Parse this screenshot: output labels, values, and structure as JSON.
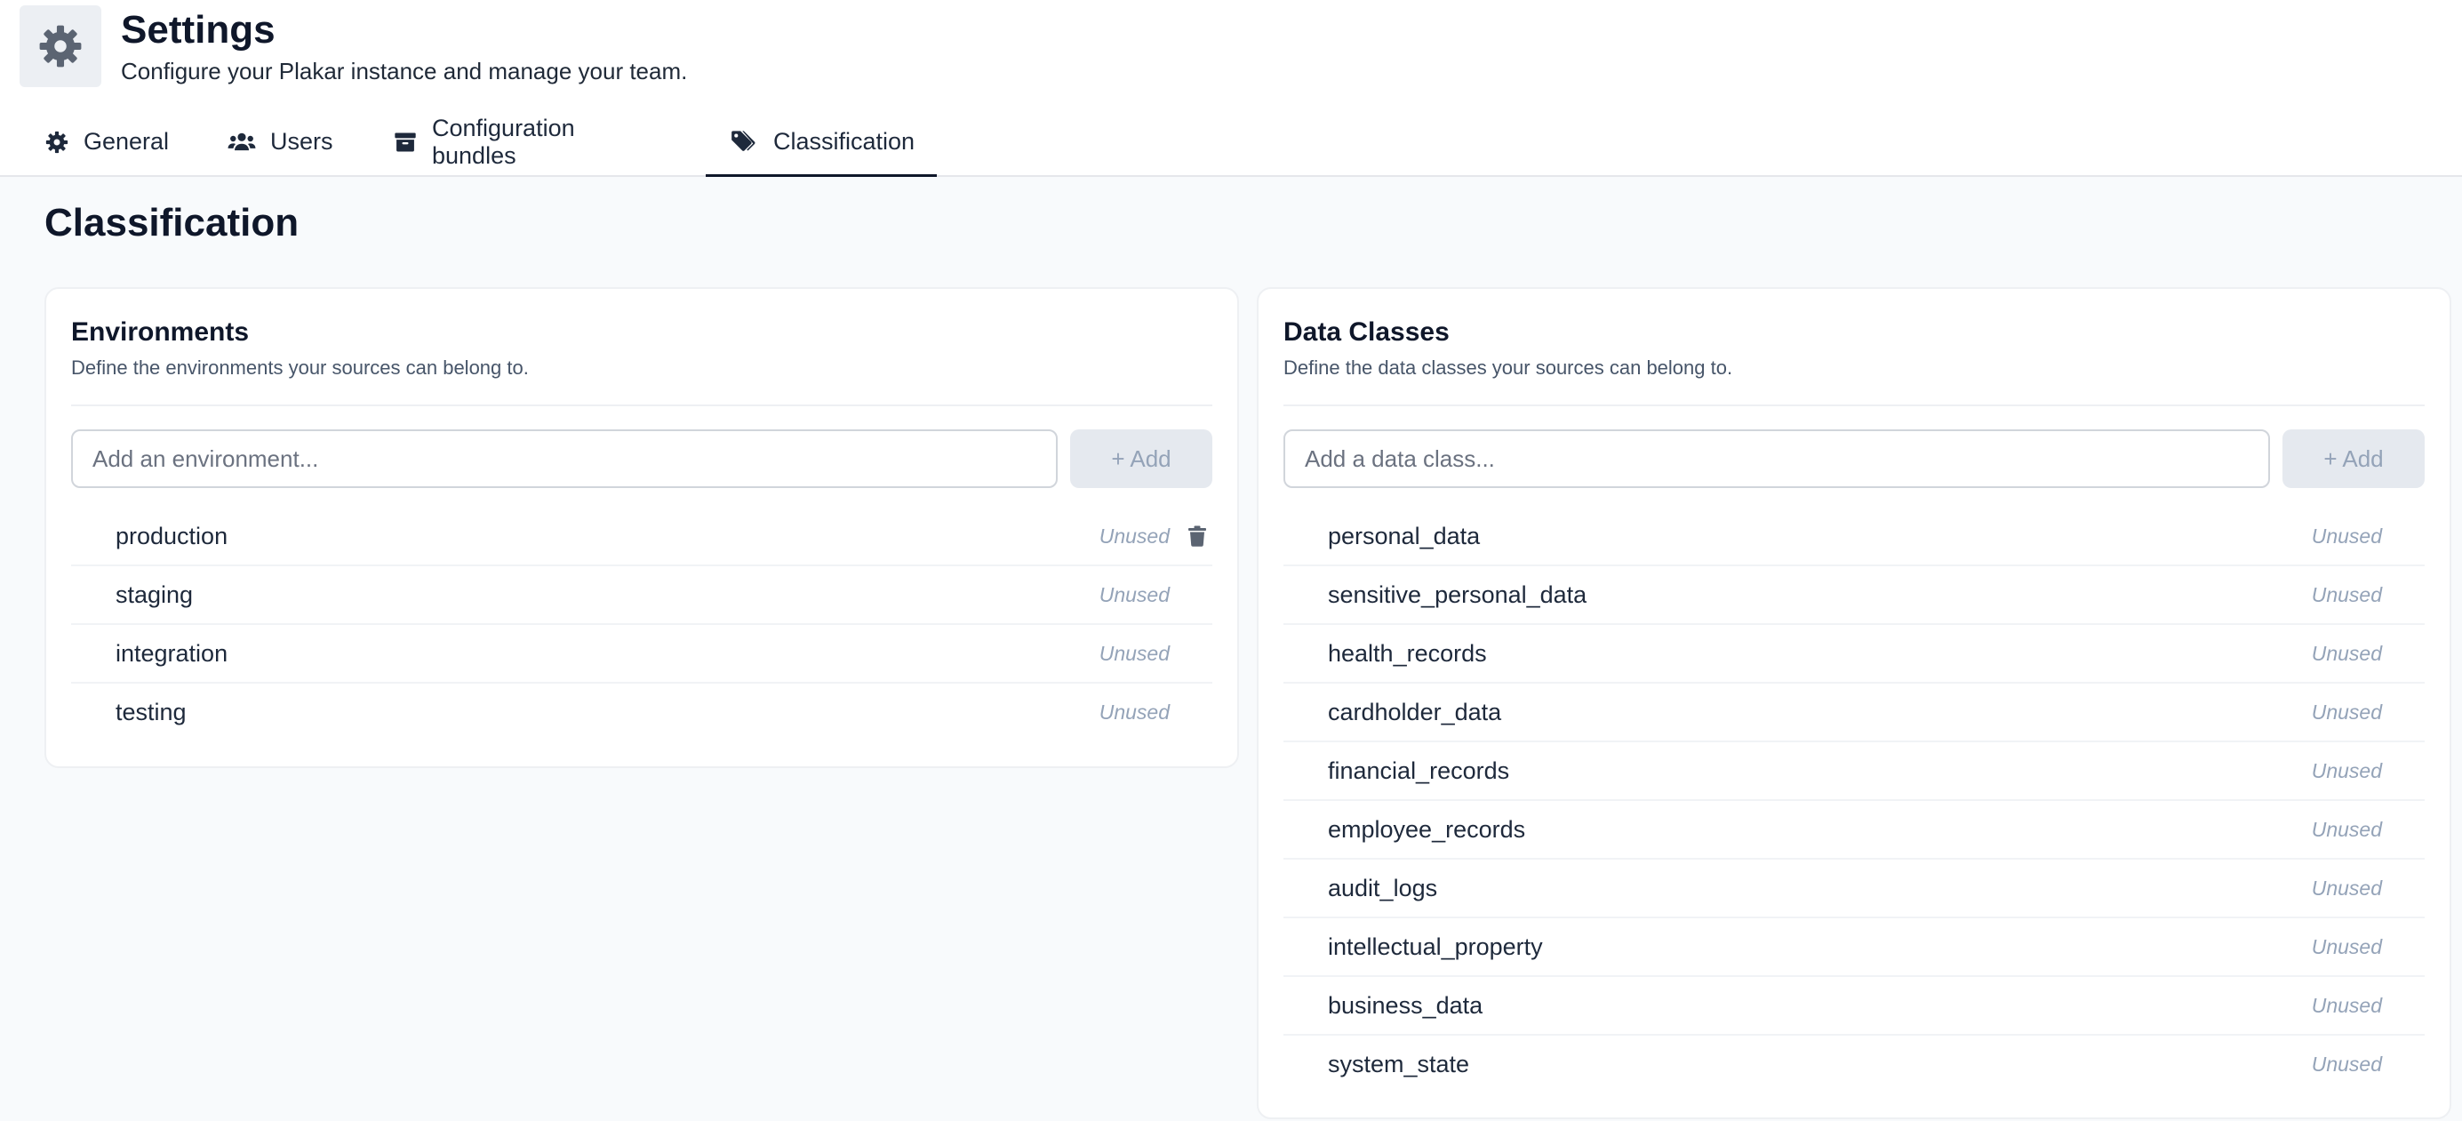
{
  "header": {
    "title": "Settings",
    "subtitle": "Configure your Plakar instance and manage your team.",
    "icon": "gear-icon"
  },
  "tabs": [
    {
      "label": "General",
      "icon": "gear-icon",
      "active": false
    },
    {
      "label": "Users",
      "icon": "users-icon",
      "active": false
    },
    {
      "label": "Configuration bundles",
      "icon": "box-icon",
      "active": false
    },
    {
      "label": "Classification",
      "icon": "tags-icon",
      "active": true
    }
  ],
  "section": {
    "title": "Classification"
  },
  "environments": {
    "title": "Environments",
    "description": "Define the environments your sources can belong to.",
    "input_placeholder": "Add an environment...",
    "add_label": "+ Add",
    "items": [
      {
        "name": "production",
        "status": "Unused"
      },
      {
        "name": "staging",
        "status": "Unused"
      },
      {
        "name": "integration",
        "status": "Unused"
      },
      {
        "name": "testing",
        "status": "Unused"
      }
    ]
  },
  "data_classes": {
    "title": "Data Classes",
    "description": "Define the data classes your sources can belong to.",
    "input_placeholder": "Add a data class...",
    "add_label": "+ Add",
    "items": [
      {
        "name": "personal_data",
        "status": "Unused"
      },
      {
        "name": "sensitive_personal_data",
        "status": "Unused"
      },
      {
        "name": "health_records",
        "status": "Unused"
      },
      {
        "name": "cardholder_data",
        "status": "Unused"
      },
      {
        "name": "financial_records",
        "status": "Unused"
      },
      {
        "name": "employee_records",
        "status": "Unused"
      },
      {
        "name": "audit_logs",
        "status": "Unused"
      },
      {
        "name": "intellectual_property",
        "status": "Unused"
      },
      {
        "name": "business_data",
        "status": "Unused"
      },
      {
        "name": "system_state",
        "status": "Unused"
      }
    ]
  },
  "colors": {
    "accent": "#0f172a",
    "muted": "#94a3b8",
    "background": "#f8fafc"
  }
}
